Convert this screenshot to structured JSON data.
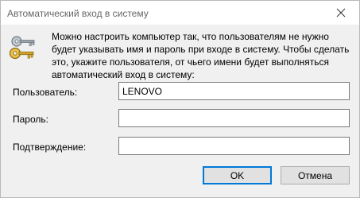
{
  "window": {
    "title": "Автоматический вход в систему"
  },
  "description": "Можно настроить компьютер так, что пользователям не нужно будет указывать имя и пароль при входе в систему. Чтобы сделать это, укажите пользователя, от чьего имени будет выполняться автоматический вход в систему:",
  "fields": {
    "user": {
      "label": "Пользователь:",
      "value": "LENOVO"
    },
    "password": {
      "label": "Пароль:",
      "value": ""
    },
    "confirm": {
      "label": "Подтверждение:",
      "value": ""
    }
  },
  "buttons": {
    "ok": "OK",
    "cancel": "Отмена"
  },
  "icons": {
    "close": "close-icon",
    "keys": "keys-icon"
  },
  "colors": {
    "dialog_bg": "#f0f0f0",
    "titlebar_bg": "#ffffff",
    "default_button_border": "#0078d7",
    "key_gold": "#d4a72c",
    "key_gray": "#9aa4ad"
  }
}
